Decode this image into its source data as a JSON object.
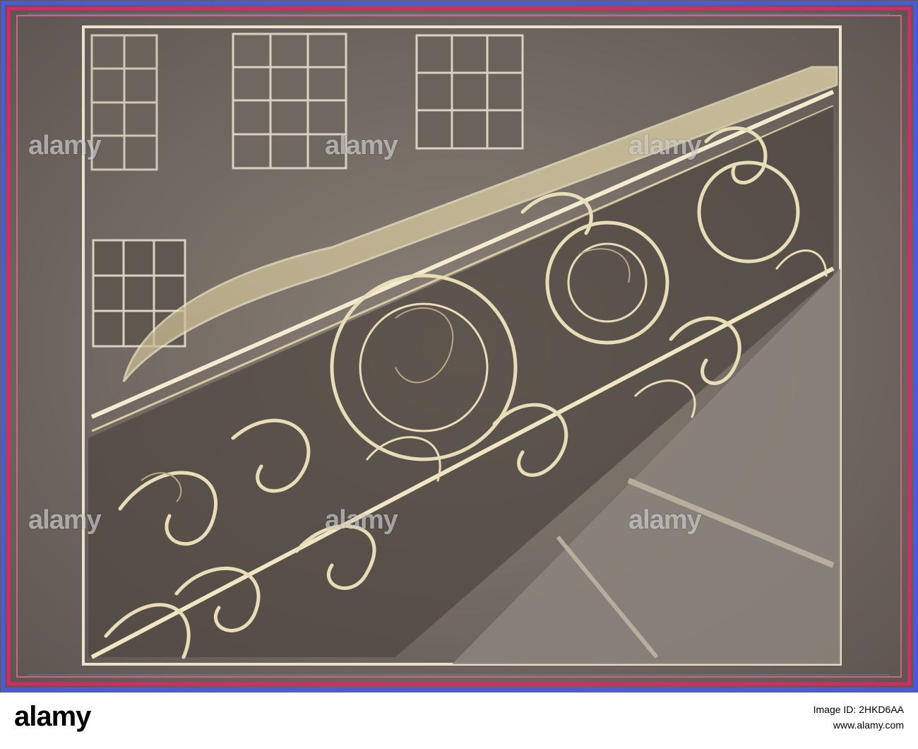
{
  "watermark": {
    "text": "alamy"
  },
  "footer": {
    "logo": "alamy",
    "image_id_line": "Image ID: 2HKD6AA",
    "url": "www.alamy.com"
  },
  "colors": {
    "background": "#7a7268",
    "frame_glow": "#d42a6a",
    "frame_blue": "#4a5ad8",
    "ironwork": "#e8ddb8",
    "footer_bg": "#ffffff"
  }
}
